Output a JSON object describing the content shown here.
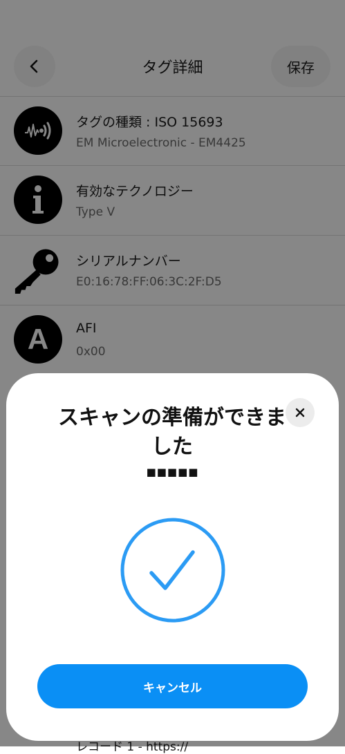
{
  "header": {
    "title": "タグ詳細",
    "save_label": "保存"
  },
  "rows": [
    {
      "icon": "nfc-wave-icon",
      "title": "タグの種類 : ISO 15693",
      "subtitle": "EM Microelectronic - EM4425"
    },
    {
      "icon": "info-icon",
      "title": "有効なテクノロジー",
      "subtitle": "Type V"
    },
    {
      "icon": "key-icon",
      "title": "シリアルナンバー",
      "subtitle": "E0:16:78:FF:06:3C:2F:D5"
    },
    {
      "icon": "afi-letter-icon",
      "icon_letter": "A",
      "title": "AFI",
      "subtitle": "0x00"
    }
  ],
  "peek_text": "レコード 1 - https://",
  "scan_sheet": {
    "title": "スキャンの準備ができました",
    "id_text": "■■■■■",
    "cancel_label": "キャンセル",
    "status_icon": "checkmark-circle-icon"
  },
  "colors": {
    "accent": "#0a8ff5",
    "check": "#2b9bf4",
    "overlay": "rgba(0,0,0,0.47)"
  }
}
